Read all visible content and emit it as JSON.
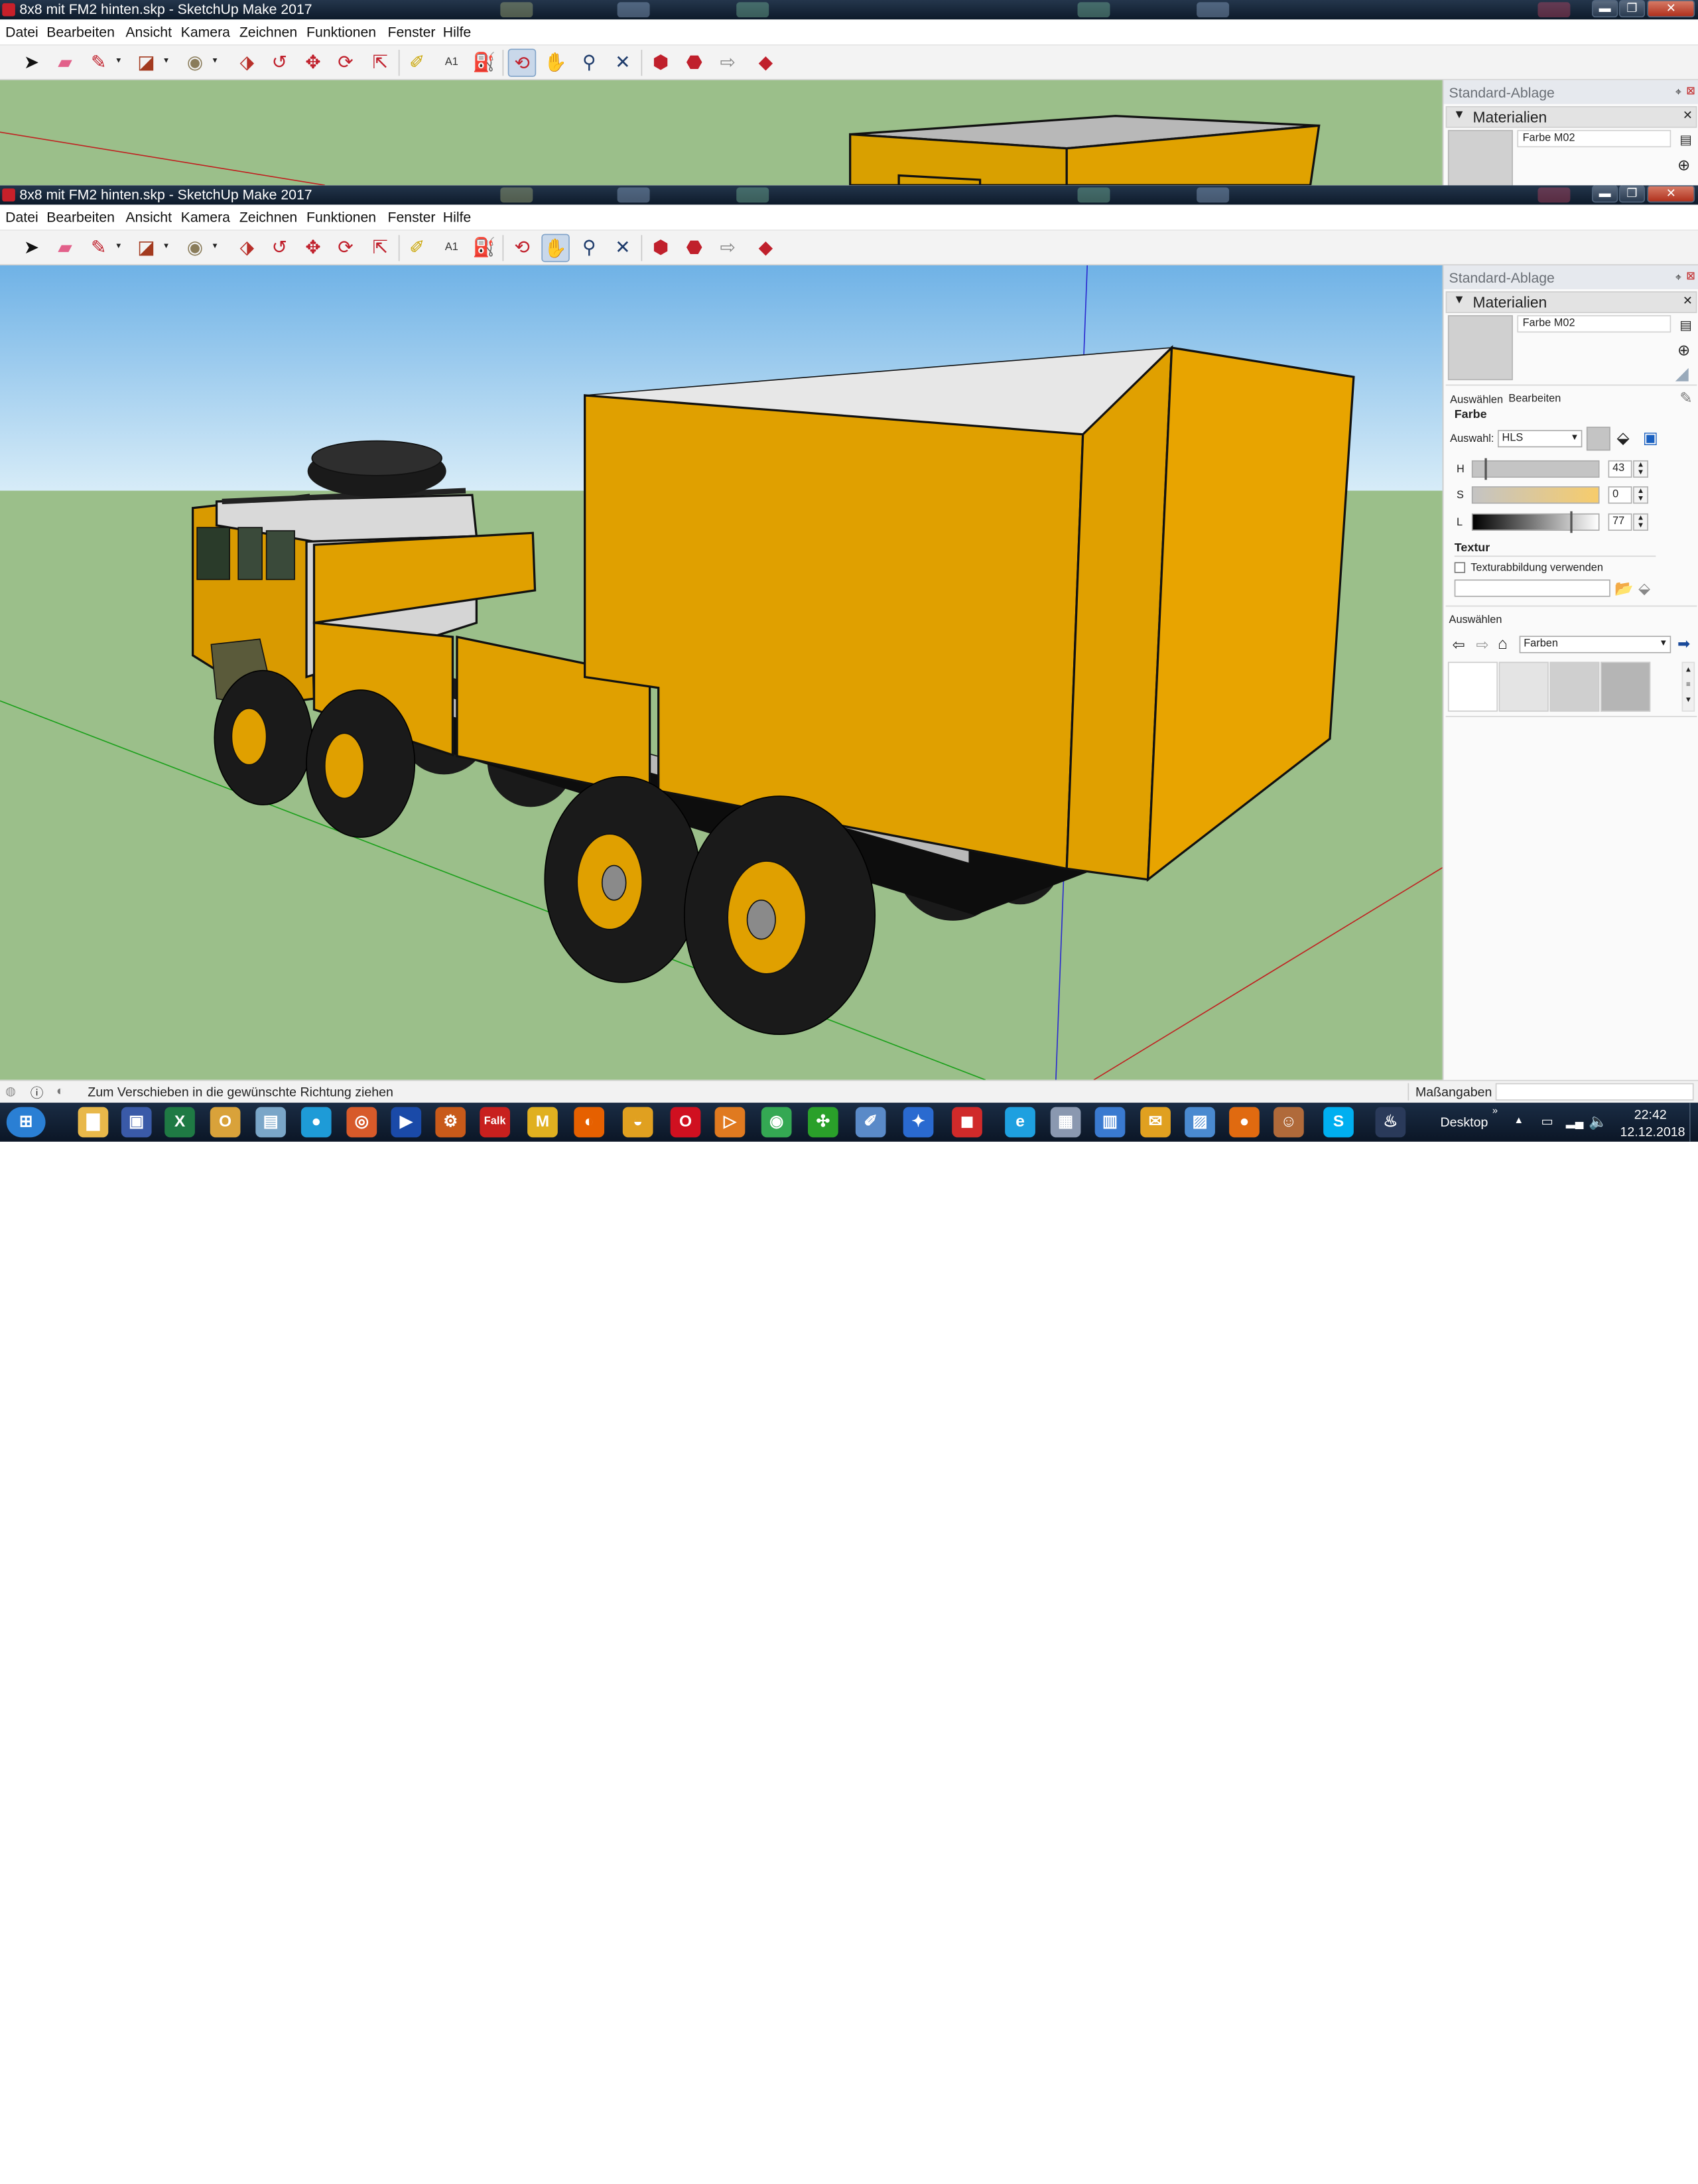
{
  "window_title": "8x8 mit FM2 hinten.skp - SketchUp Make 2017",
  "menu": [
    "Datei",
    "Bearbeiten",
    "Ansicht",
    "Kamera",
    "Zeichnen",
    "Funktionen",
    "Fenster",
    "Hilfe"
  ],
  "window_buttons": {
    "minimize": "▬",
    "restore": "❐",
    "close": "✕"
  },
  "tools": [
    {
      "name": "select-tool-icon",
      "glyph": "➤",
      "color": "#111111"
    },
    {
      "name": "eraser-tool-icon",
      "glyph": "▰",
      "color": "#e2608a"
    },
    {
      "name": "pencil-tool-icon",
      "glyph": "✎",
      "color": "#c0202c",
      "dropdown": true
    },
    {
      "name": "arc-tool-icon",
      "glyph": "◪",
      "color": "#a33a1f",
      "dropdown": true
    },
    {
      "name": "circle-tool-icon",
      "glyph": "◉",
      "color": "#8a7c5a",
      "dropdown": true
    },
    {
      "name": "push-pull-icon",
      "glyph": "⬗",
      "color": "#b8302a"
    },
    {
      "name": "follow-me-icon",
      "glyph": "↺",
      "color": "#c0202c"
    },
    {
      "name": "move-tool-icon",
      "glyph": "✥",
      "color": "#c0202c"
    },
    {
      "name": "rotate-tool-icon",
      "glyph": "⟳",
      "color": "#c0202c"
    },
    {
      "name": "scale-tool-icon",
      "glyph": "⇱",
      "color": "#c0202c"
    },
    {
      "name": "tape-measure-icon",
      "glyph": "✐",
      "color": "#c9a400"
    },
    {
      "name": "text-tool-icon",
      "glyph": "A1",
      "color": "#333333"
    },
    {
      "name": "paint-bucket-icon",
      "glyph": "⛽",
      "color": "#333333"
    },
    {
      "name": "orbit-tool-icon",
      "glyph": "⟲",
      "color": "#c0202c"
    },
    {
      "name": "pan-tool-icon",
      "glyph": "✋",
      "color": "#d8a060"
    },
    {
      "name": "zoom-tool-icon",
      "glyph": "⚲",
      "color": "#1f3c6c"
    },
    {
      "name": "zoom-extents-icon",
      "glyph": "✕",
      "color": "#1f3c6c"
    },
    {
      "name": "warehouse-icon",
      "glyph": "⬢",
      "color": "#c0202c"
    },
    {
      "name": "extension-warehouse-icon",
      "glyph": "⬣",
      "color": "#c0202c"
    },
    {
      "name": "share-model-icon",
      "glyph": "⇨",
      "color": "#888888"
    },
    {
      "name": "ruby-extension-icon",
      "glyph": "◆",
      "color": "#c0202c"
    }
  ],
  "back_window": {
    "active_tool_index": 13
  },
  "front_window": {
    "active_tool_index": 14
  },
  "tray": {
    "header": "Standard-Ablage",
    "materials_title": "Materialien",
    "material_name": "Farbe M02",
    "tab_select": "Auswählen",
    "tab_edit": "Bearbeiten",
    "color_heading": "Farbe",
    "picker_label": "Auswahl:",
    "picker_value": "HLS",
    "h_label": "H",
    "h_value": "43",
    "s_label": "S",
    "s_value": "0",
    "l_label": "L",
    "l_value": "77",
    "texture_heading": "Textur",
    "texture_checkbox": "Texturabbildung verwenden",
    "select_heading": "Auswählen",
    "library_value": "Farben"
  },
  "status": {
    "hint": "Zum Verschieben in die gewünschte Richtung ziehen",
    "measure_label": "Maßangaben"
  },
  "taskbar": {
    "desktop_label": "Desktop",
    "time": "22:42",
    "date": "12.12.2018",
    "apps": [
      {
        "name": "windows-start-icon",
        "glyph": "⊞",
        "color": "#2a7fd4"
      },
      {
        "name": "file-explorer-icon",
        "glyph": "▇",
        "color": "#e8b84a"
      },
      {
        "name": "floppy-save-icon",
        "glyph": "▣",
        "color": "#3a5aa8"
      },
      {
        "name": "excel-icon",
        "glyph": "X",
        "color": "#1f7a44"
      },
      {
        "name": "outlook-icon",
        "glyph": "O",
        "color": "#d9a23a"
      },
      {
        "name": "notes-icon",
        "glyph": "▤",
        "color": "#7aa6c8"
      },
      {
        "name": "globe-app-icon",
        "glyph": "●",
        "color": "#1e9bd7"
      },
      {
        "name": "eye-app-icon",
        "glyph": "◎",
        "color": "#d75a2a"
      },
      {
        "name": "video-app-icon",
        "glyph": "▶",
        "color": "#1a4aa8"
      },
      {
        "name": "tools-app-icon",
        "glyph": "⚙",
        "color": "#c85a1a"
      },
      {
        "name": "falk-navigator-icon",
        "glyph": "Falk",
        "color": "#c8201e"
      },
      {
        "name": "m-app-icon",
        "glyph": "M",
        "color": "#e0b020"
      },
      {
        "name": "firefox-icon",
        "glyph": "◐",
        "color": "#e66000"
      },
      {
        "name": "ball-app-icon",
        "glyph": "◒",
        "color": "#e0a020"
      },
      {
        "name": "opera-icon",
        "glyph": "O",
        "color": "#d01020"
      },
      {
        "name": "media-player-icon",
        "glyph": "▷",
        "color": "#e07a20"
      },
      {
        "name": "chrome-icon",
        "glyph": "◉",
        "color": "#34a853"
      },
      {
        "name": "green-app-icon",
        "glyph": "✣",
        "color": "#2aa02a"
      },
      {
        "name": "paint-app-icon",
        "glyph": "✐",
        "color": "#5a8ac8"
      },
      {
        "name": "blue-star-app-icon",
        "glyph": "✦",
        "color": "#2a6ad0"
      },
      {
        "name": "sketchup-taskbar-icon",
        "glyph": "◼",
        "color": "#d02a2a"
      },
      {
        "name": "internet-explorer-icon",
        "glyph": "e",
        "color": "#1ea0e0"
      },
      {
        "name": "calculator-icon",
        "glyph": "▦",
        "color": "#8a98b0"
      },
      {
        "name": "control-panel-icon",
        "glyph": "▥",
        "color": "#3a7ad0"
      },
      {
        "name": "mail-app-icon",
        "glyph": "✉",
        "color": "#e0a020"
      },
      {
        "name": "network-app-icon",
        "glyph": "▨",
        "color": "#4a8ad0"
      },
      {
        "name": "orange-app-icon",
        "glyph": "●",
        "color": "#e06a10"
      },
      {
        "name": "avatar-app-icon",
        "glyph": "☺",
        "color": "#b06a3a"
      },
      {
        "name": "skype-icon",
        "glyph": "S",
        "color": "#00aff0"
      },
      {
        "name": "steam-icon",
        "glyph": "♨",
        "color": "#2a3a5a"
      }
    ]
  }
}
